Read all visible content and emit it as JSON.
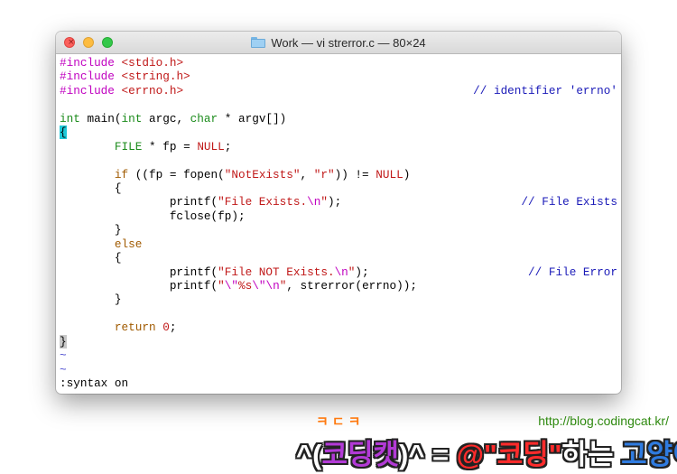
{
  "window": {
    "title": "Work — vi strerror.c — 80×24"
  },
  "editor": {
    "lines": {
      "l1": {
        "a": "#include ",
        "b": "<stdio.h>"
      },
      "l2": {
        "a": "#include ",
        "b": "<string.h>"
      },
      "l3": {
        "a": "#include ",
        "b": "<errno.h>",
        "comment": "// identifier 'errno'"
      },
      "l5": {
        "a": "int",
        "b": " main(",
        "c": "int",
        "d": " argc, ",
        "e": "char",
        "f": " * argv[])"
      },
      "l6": {
        "brace": "{"
      },
      "l7": {
        "indent": "        ",
        "a": "FILE",
        "b": " * fp = ",
        "c": "NULL",
        "d": ";"
      },
      "l9": {
        "indent": "        ",
        "a": "if",
        "b": " ((fp = fopen(",
        "c": "\"NotExists\"",
        "d": ", ",
        "e": "\"r\"",
        "f": ")) != ",
        "g": "NULL",
        "h": ")"
      },
      "l10": {
        "text": "        {"
      },
      "l11": {
        "a": "                printf(",
        "b": "\"File Exists.",
        "c": "\\n",
        "d": "\"",
        "e": ");",
        "comment": "// File Exists"
      },
      "l12": {
        "text": "                fclose(fp);"
      },
      "l13": {
        "text": "        }"
      },
      "l14": {
        "indent": "        ",
        "a": "else"
      },
      "l15": {
        "text": "        {"
      },
      "l16": {
        "a": "                printf(",
        "b": "\"File NOT Exists.",
        "c": "\\n",
        "d": "\"",
        "e": ");",
        "comment": "// File Error"
      },
      "l17": {
        "a": "                printf(",
        "b": "\"",
        "c": "\\\"",
        "d": "%s",
        "e": "\\\"",
        "f": "\\n",
        "g": "\"",
        "h": ", strerror(errno));"
      },
      "l18": {
        "text": "        }"
      },
      "l20": {
        "indent": "        ",
        "a": "return",
        "b": " ",
        "c": "0",
        "d": ";"
      },
      "l21": {
        "brace": "}"
      },
      "l22": {
        "tilde": "~"
      },
      "l23": {
        "tilde": "~"
      }
    },
    "command_line": ":syntax on"
  },
  "watermark": {
    "url": "http://blog.codingcat.kr/",
    "small_label": "ㅋㄷㅋ",
    "main_a": "^(",
    "main_b": "코딩캣",
    "main_c": ")^ = ",
    "main_d": "@\"코딩\"",
    "main_e": "하는 ",
    "main_f": "고양이;"
  },
  "colors": {
    "preprocessor": "#c000c0",
    "type": "#1b8b1b",
    "string": "#c01818",
    "keyword": "#a05a00",
    "comment": "#1a1ab8",
    "cursor": "#1ec8d8"
  }
}
